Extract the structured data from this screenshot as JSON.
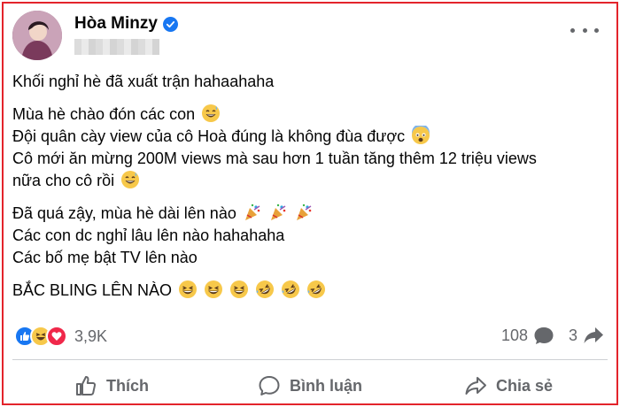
{
  "post": {
    "author": "Hòa Minzy",
    "verified": true,
    "lines": [
      "Khối nghỉ hè đã xuất trận hahaahaha",
      "Mùa hè chào đón các con",
      "Đội quân cày view của cô Hoà đúng là không đùa được",
      "Cô mới ăn mừng 200M views mà sau hơn 1 tuần tăng thêm 12 triệu views",
      "nữa cho cô rồi",
      "Đã quá zậy, mùa hè dài lên nào",
      "Các con dc nghỉ lâu lên nào hahahaha",
      "Các bố mẹ bật TV lên nào",
      "BẮC BLING LÊN NÀO"
    ],
    "icons": {
      "verified": "verified-badge-icon",
      "more": "more-options-icon"
    }
  },
  "stats": {
    "reaction_count": "3,9K",
    "reaction_types": [
      "like",
      "haha",
      "love"
    ],
    "comments": "108",
    "shares": "3"
  },
  "actions": {
    "like": "Thích",
    "comment": "Bình luận",
    "share": "Chia sẻ"
  },
  "colors": {
    "frame": "#e3242b",
    "brand": "#1877f2",
    "secondary_text": "#65676b"
  }
}
